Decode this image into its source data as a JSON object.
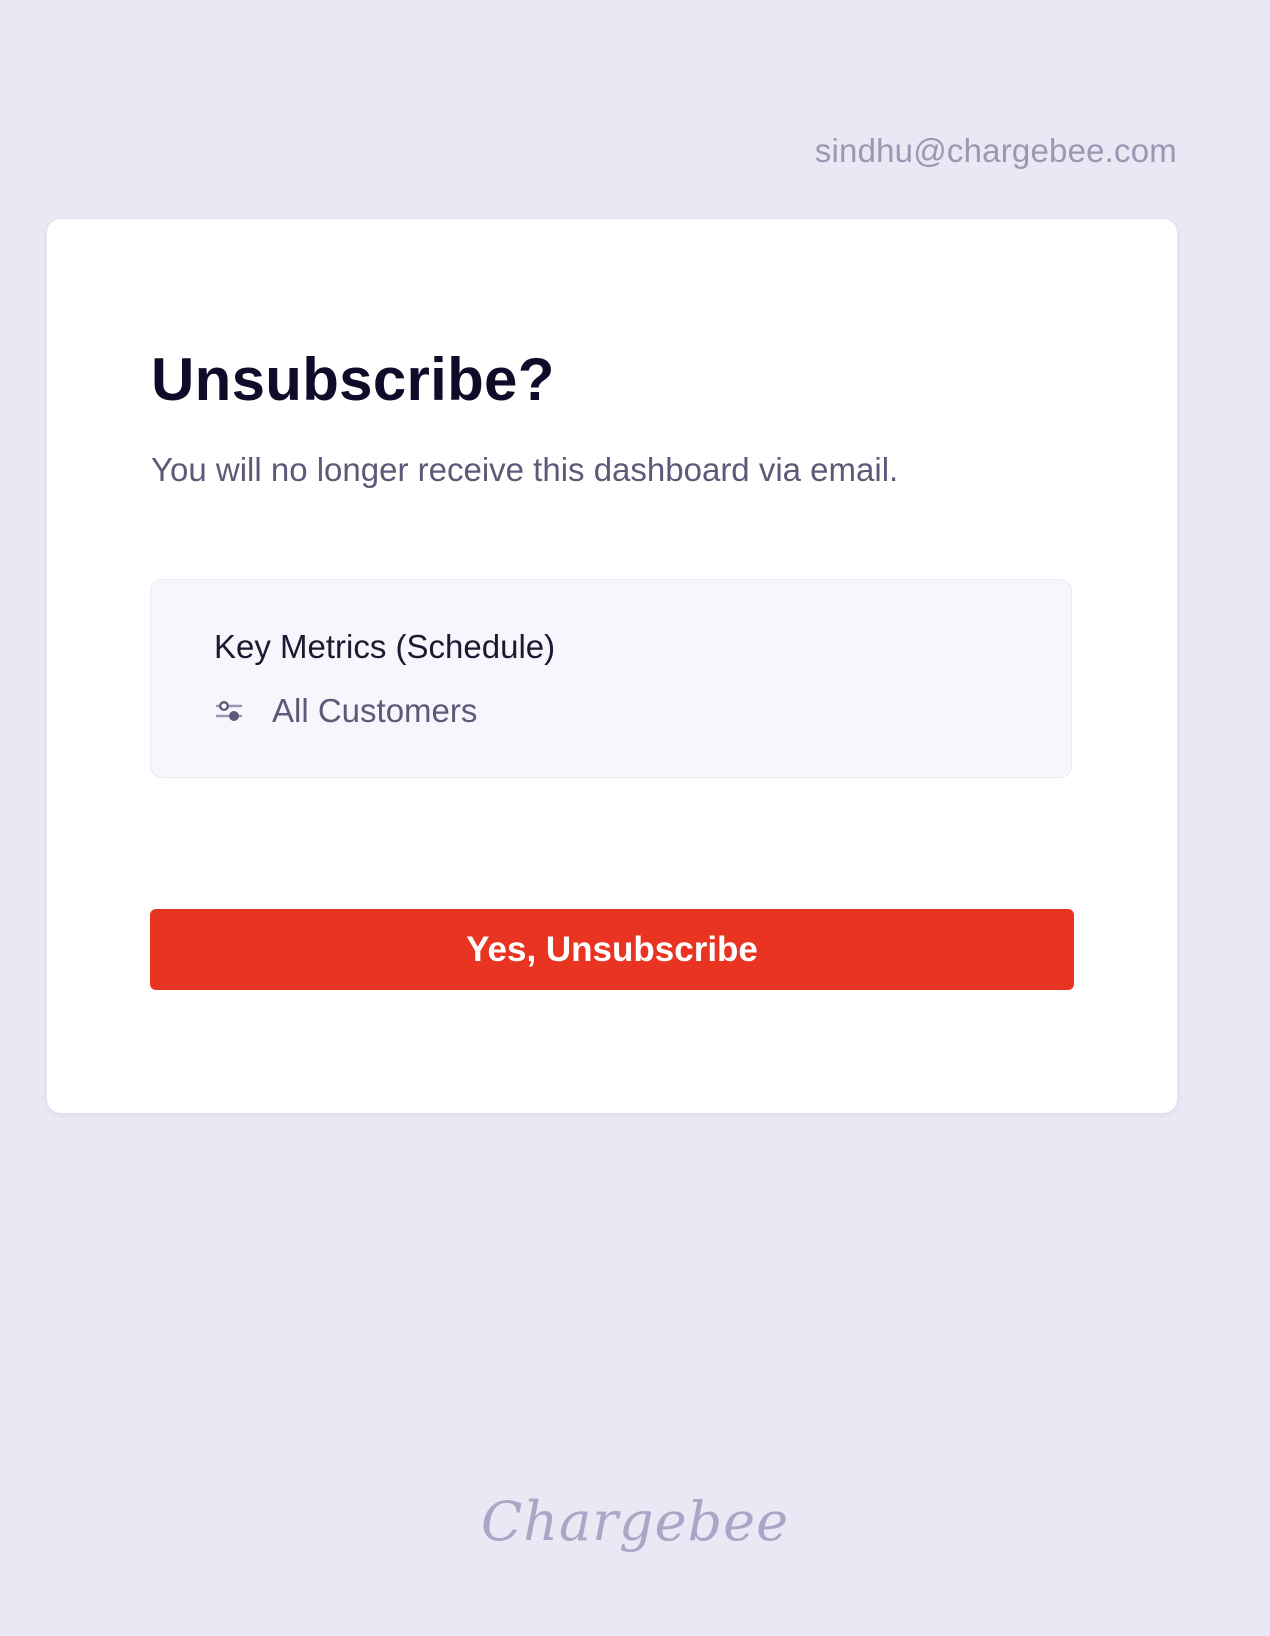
{
  "header": {
    "user_email": "sindhu@chargebee.com"
  },
  "dialog": {
    "title": "Unsubscribe?",
    "message": "You will no longer receive this dashboard via email.",
    "dashboard": {
      "name": "Key Metrics (Schedule)",
      "filter_icon": "filter-sliders-icon",
      "filter_label": "All Customers"
    },
    "confirm_button_label": "Yes, Unsubscribe"
  },
  "footer": {
    "brand": "Chargebee"
  },
  "colors": {
    "background": "#eae8f5",
    "card": "#ffffff",
    "danger": "#e93422",
    "muted_text": "#5d5a78",
    "brand_logo": "#a9a6c6"
  }
}
